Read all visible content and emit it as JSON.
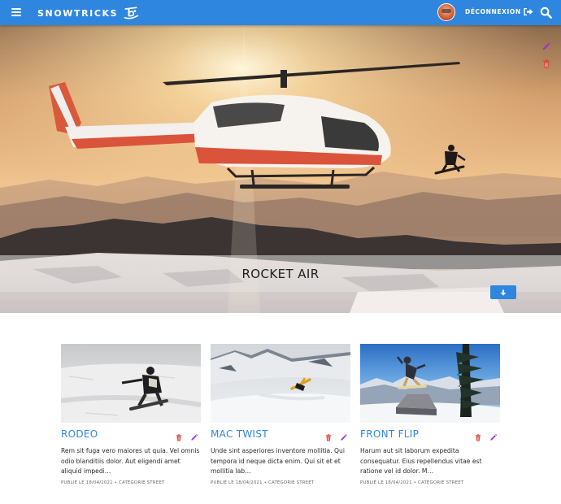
{
  "navbar": {
    "brand": "SNOWTRICKS",
    "logout_label": "DÉCONNEXION",
    "menu_icon": "hamburger-icon",
    "logout_icon": "sign-out-icon",
    "search_icon": "search-icon",
    "color": "#2f86df"
  },
  "hero": {
    "title": "ROCKET AIR",
    "edit_icon": "pencil-icon",
    "delete_icon": "trash-icon",
    "scroll_icon": "arrow-down-icon"
  },
  "tricks": [
    {
      "title": "RODEO",
      "description": "Rem sit fuga vero maiores ut quia. Vel omnis odio blanditiis dolor. Aut eligendi amet aliquid impedi…",
      "meta": "PUBLIÉ LE 18/04/2021 • CATÉGORIE STREET"
    },
    {
      "title": "MAC TWIST",
      "description": "Unde sint asperiores inventore mollitia. Qui tempora id neque dicta enim. Qui sit et et mollitia lab…",
      "meta": "PUBLIÉ LE 18/04/2021 • CATÉGORIE STREET"
    },
    {
      "title": "FRONT FLIP",
      "description": "Harum aut sit laborum expedita consequatur. Eius repellendus vitae est ratione vel id dolor. M…",
      "meta": "PUBLIÉ LE 18/04/2021 • CATÉGORIE STREET"
    }
  ],
  "colors": {
    "accent": "#2f86df",
    "edit": "#9b2fd6",
    "delete": "#e0433a"
  }
}
